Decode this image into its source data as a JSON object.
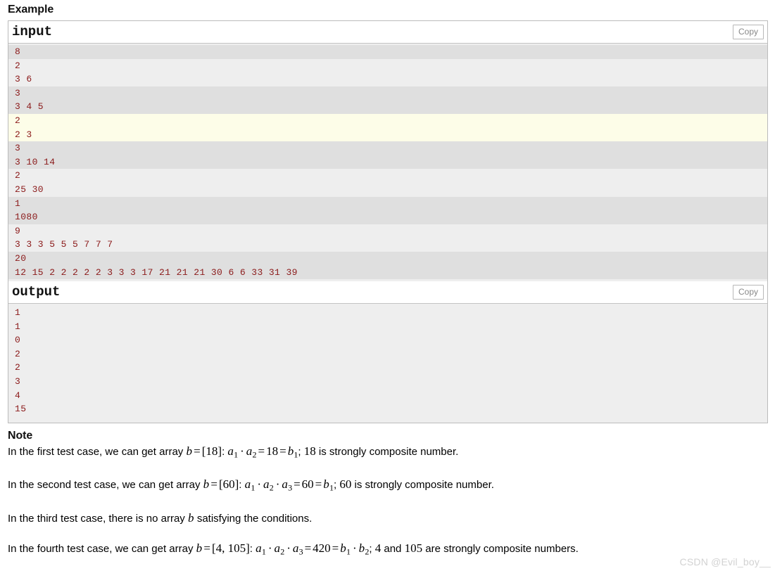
{
  "page": {
    "example_heading": "Example",
    "note_heading": "Note"
  },
  "sample_tests": {
    "input": {
      "label": "input",
      "copy_label": "Copy",
      "groups": [
        {
          "shade": "dark",
          "lines": [
            "8"
          ]
        },
        {
          "shade": "light",
          "lines": [
            "2",
            "3 6"
          ]
        },
        {
          "shade": "dark",
          "lines": [
            "3",
            "3 4 5"
          ]
        },
        {
          "shade": "hl",
          "lines": [
            "2",
            "2 3"
          ]
        },
        {
          "shade": "dark",
          "lines": [
            "3",
            "3 10 14"
          ]
        },
        {
          "shade": "light",
          "lines": [
            "2",
            "25 30"
          ]
        },
        {
          "shade": "dark",
          "lines": [
            "1",
            "1080"
          ]
        },
        {
          "shade": "light",
          "lines": [
            "9",
            "3 3 3 5 5 5 7 7 7"
          ]
        },
        {
          "shade": "dark",
          "lines": [
            "20",
            "12 15 2 2 2 2 2 3 3 3 17 21 21 21 30 6 6 33 31 39"
          ]
        }
      ]
    },
    "output": {
      "label": "output",
      "copy_label": "Copy",
      "lines": [
        "1",
        "1",
        "0",
        "2",
        "2",
        "3",
        "4",
        "15"
      ]
    }
  },
  "note": {
    "paragraphs": [
      {
        "id": "note-1",
        "parts": [
          {
            "t": "text",
            "v": "In the first test case, we can get array "
          },
          {
            "t": "mi",
            "v": "b"
          },
          {
            "t": "op",
            "v": "="
          },
          {
            "t": "mn",
            "v": "[18]"
          },
          {
            "t": "text",
            "v": ": "
          },
          {
            "t": "mi",
            "v": "a"
          },
          {
            "t": "sub",
            "v": "1"
          },
          {
            "t": "dot",
            "v": "·"
          },
          {
            "t": "mi",
            "v": "a"
          },
          {
            "t": "sub",
            "v": "2"
          },
          {
            "t": "op",
            "v": "="
          },
          {
            "t": "mn",
            "v": "18"
          },
          {
            "t": "op",
            "v": "="
          },
          {
            "t": "mi",
            "v": "b"
          },
          {
            "t": "sub",
            "v": "1"
          },
          {
            "t": "text",
            "v": "; "
          },
          {
            "t": "mn",
            "v": "18"
          },
          {
            "t": "text",
            "v": " is strongly composite number."
          }
        ]
      },
      {
        "id": "note-2",
        "parts": [
          {
            "t": "text",
            "v": "In the second test case, we can get array "
          },
          {
            "t": "mi",
            "v": "b"
          },
          {
            "t": "op",
            "v": "="
          },
          {
            "t": "mn",
            "v": "[60]"
          },
          {
            "t": "text",
            "v": ": "
          },
          {
            "t": "mi",
            "v": "a"
          },
          {
            "t": "sub",
            "v": "1"
          },
          {
            "t": "dot",
            "v": "·"
          },
          {
            "t": "mi",
            "v": "a"
          },
          {
            "t": "sub",
            "v": "2"
          },
          {
            "t": "dot",
            "v": "·"
          },
          {
            "t": "mi",
            "v": "a"
          },
          {
            "t": "sub",
            "v": "3"
          },
          {
            "t": "op",
            "v": "="
          },
          {
            "t": "mn",
            "v": "60"
          },
          {
            "t": "op",
            "v": "="
          },
          {
            "t": "mi",
            "v": "b"
          },
          {
            "t": "sub",
            "v": "1"
          },
          {
            "t": "text",
            "v": "; "
          },
          {
            "t": "mn",
            "v": "60"
          },
          {
            "t": "text",
            "v": " is strongly composite number."
          }
        ]
      },
      {
        "id": "note-3",
        "parts": [
          {
            "t": "text",
            "v": "In the third test case, there is no array "
          },
          {
            "t": "mi",
            "v": "b"
          },
          {
            "t": "text",
            "v": " satisfying the conditions."
          }
        ]
      },
      {
        "id": "note-4",
        "parts": [
          {
            "t": "text",
            "v": "In the fourth test case, we can get array "
          },
          {
            "t": "mi",
            "v": "b"
          },
          {
            "t": "op",
            "v": "="
          },
          {
            "t": "mn",
            "v": "[4, 105]"
          },
          {
            "t": "text",
            "v": ": "
          },
          {
            "t": "mi",
            "v": "a"
          },
          {
            "t": "sub",
            "v": "1"
          },
          {
            "t": "dot",
            "v": "·"
          },
          {
            "t": "mi",
            "v": "a"
          },
          {
            "t": "sub",
            "v": "2"
          },
          {
            "t": "dot",
            "v": "·"
          },
          {
            "t": "mi",
            "v": "a"
          },
          {
            "t": "sub",
            "v": "3"
          },
          {
            "t": "op",
            "v": "="
          },
          {
            "t": "mn",
            "v": "420"
          },
          {
            "t": "op",
            "v": "="
          },
          {
            "t": "mi",
            "v": "b"
          },
          {
            "t": "sub",
            "v": "1"
          },
          {
            "t": "dot",
            "v": "·"
          },
          {
            "t": "mi",
            "v": "b"
          },
          {
            "t": "sub",
            "v": "2"
          },
          {
            "t": "text",
            "v": "; "
          },
          {
            "t": "mn",
            "v": "4"
          },
          {
            "t": "text",
            "v": " and "
          },
          {
            "t": "mn",
            "v": "105"
          },
          {
            "t": "text",
            "v": " are strongly composite numbers."
          }
        ]
      }
    ]
  },
  "watermark": {
    "text": "CSDN @Evil_boy__"
  },
  "colors": {
    "code_text": "#8b1a1a",
    "stripe_dark": "#dfdfdf",
    "stripe_light": "#eeeeee",
    "stripe_highlight": "#fdfde8",
    "border": "#bbbbbb",
    "copy_text": "#888888",
    "watermark": "#d2d2d2"
  }
}
